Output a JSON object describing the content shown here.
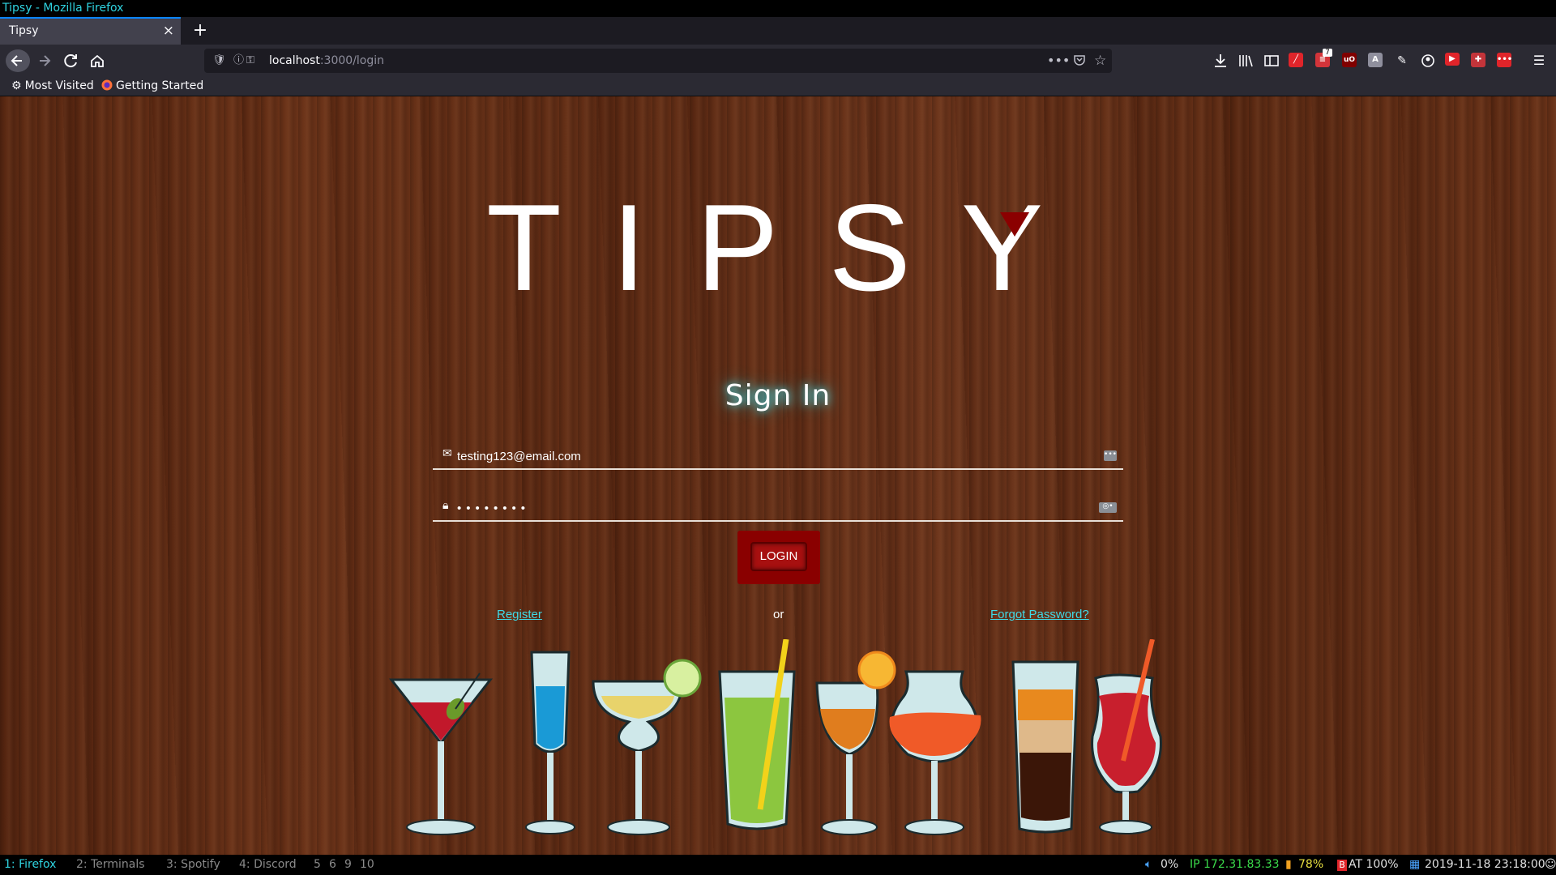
{
  "window": {
    "title": "Tipsy - Mozilla Firefox"
  },
  "tabs": [
    {
      "label": "Tipsy",
      "close": "×"
    }
  ],
  "newtab_label": "+",
  "url": {
    "host": "localhost",
    "rest": ":3000/login"
  },
  "bookmarks": [
    {
      "label": "Most Visited"
    },
    {
      "label": "Getting Started"
    }
  ],
  "extensions": {
    "badge_count": "7",
    "ublock": "uO"
  },
  "page": {
    "logo": "TIPSY",
    "heading": "Sign In",
    "email": {
      "value": "testing123@email.com"
    },
    "password": {
      "value": "••••••••"
    },
    "login_label": "LOGIN",
    "register_label": "Register",
    "or_label": "or",
    "forgot_label": "Forgot Password?"
  },
  "statusbar": {
    "workspaces": [
      {
        "label": "1: Firefox",
        "active": true
      },
      {
        "label": "2: Terminals",
        "active": false
      },
      {
        "label": "3: Spotify",
        "active": false
      },
      {
        "label": "4: Discord",
        "active": false
      },
      {
        "label": "5",
        "active": false
      },
      {
        "label": "6",
        "active": false
      },
      {
        "label": "9",
        "active": false
      },
      {
        "label": "10",
        "active": false
      }
    ],
    "volume": "0%",
    "ip": "IP 172.31.83.33",
    "wifi": "78%",
    "battery": "AT 100%",
    "datetime": "2019-11-18 23:18:00"
  },
  "colors": {
    "accent": "#2fd3e0",
    "login": "#a71010",
    "link": "#3fd9e6"
  }
}
